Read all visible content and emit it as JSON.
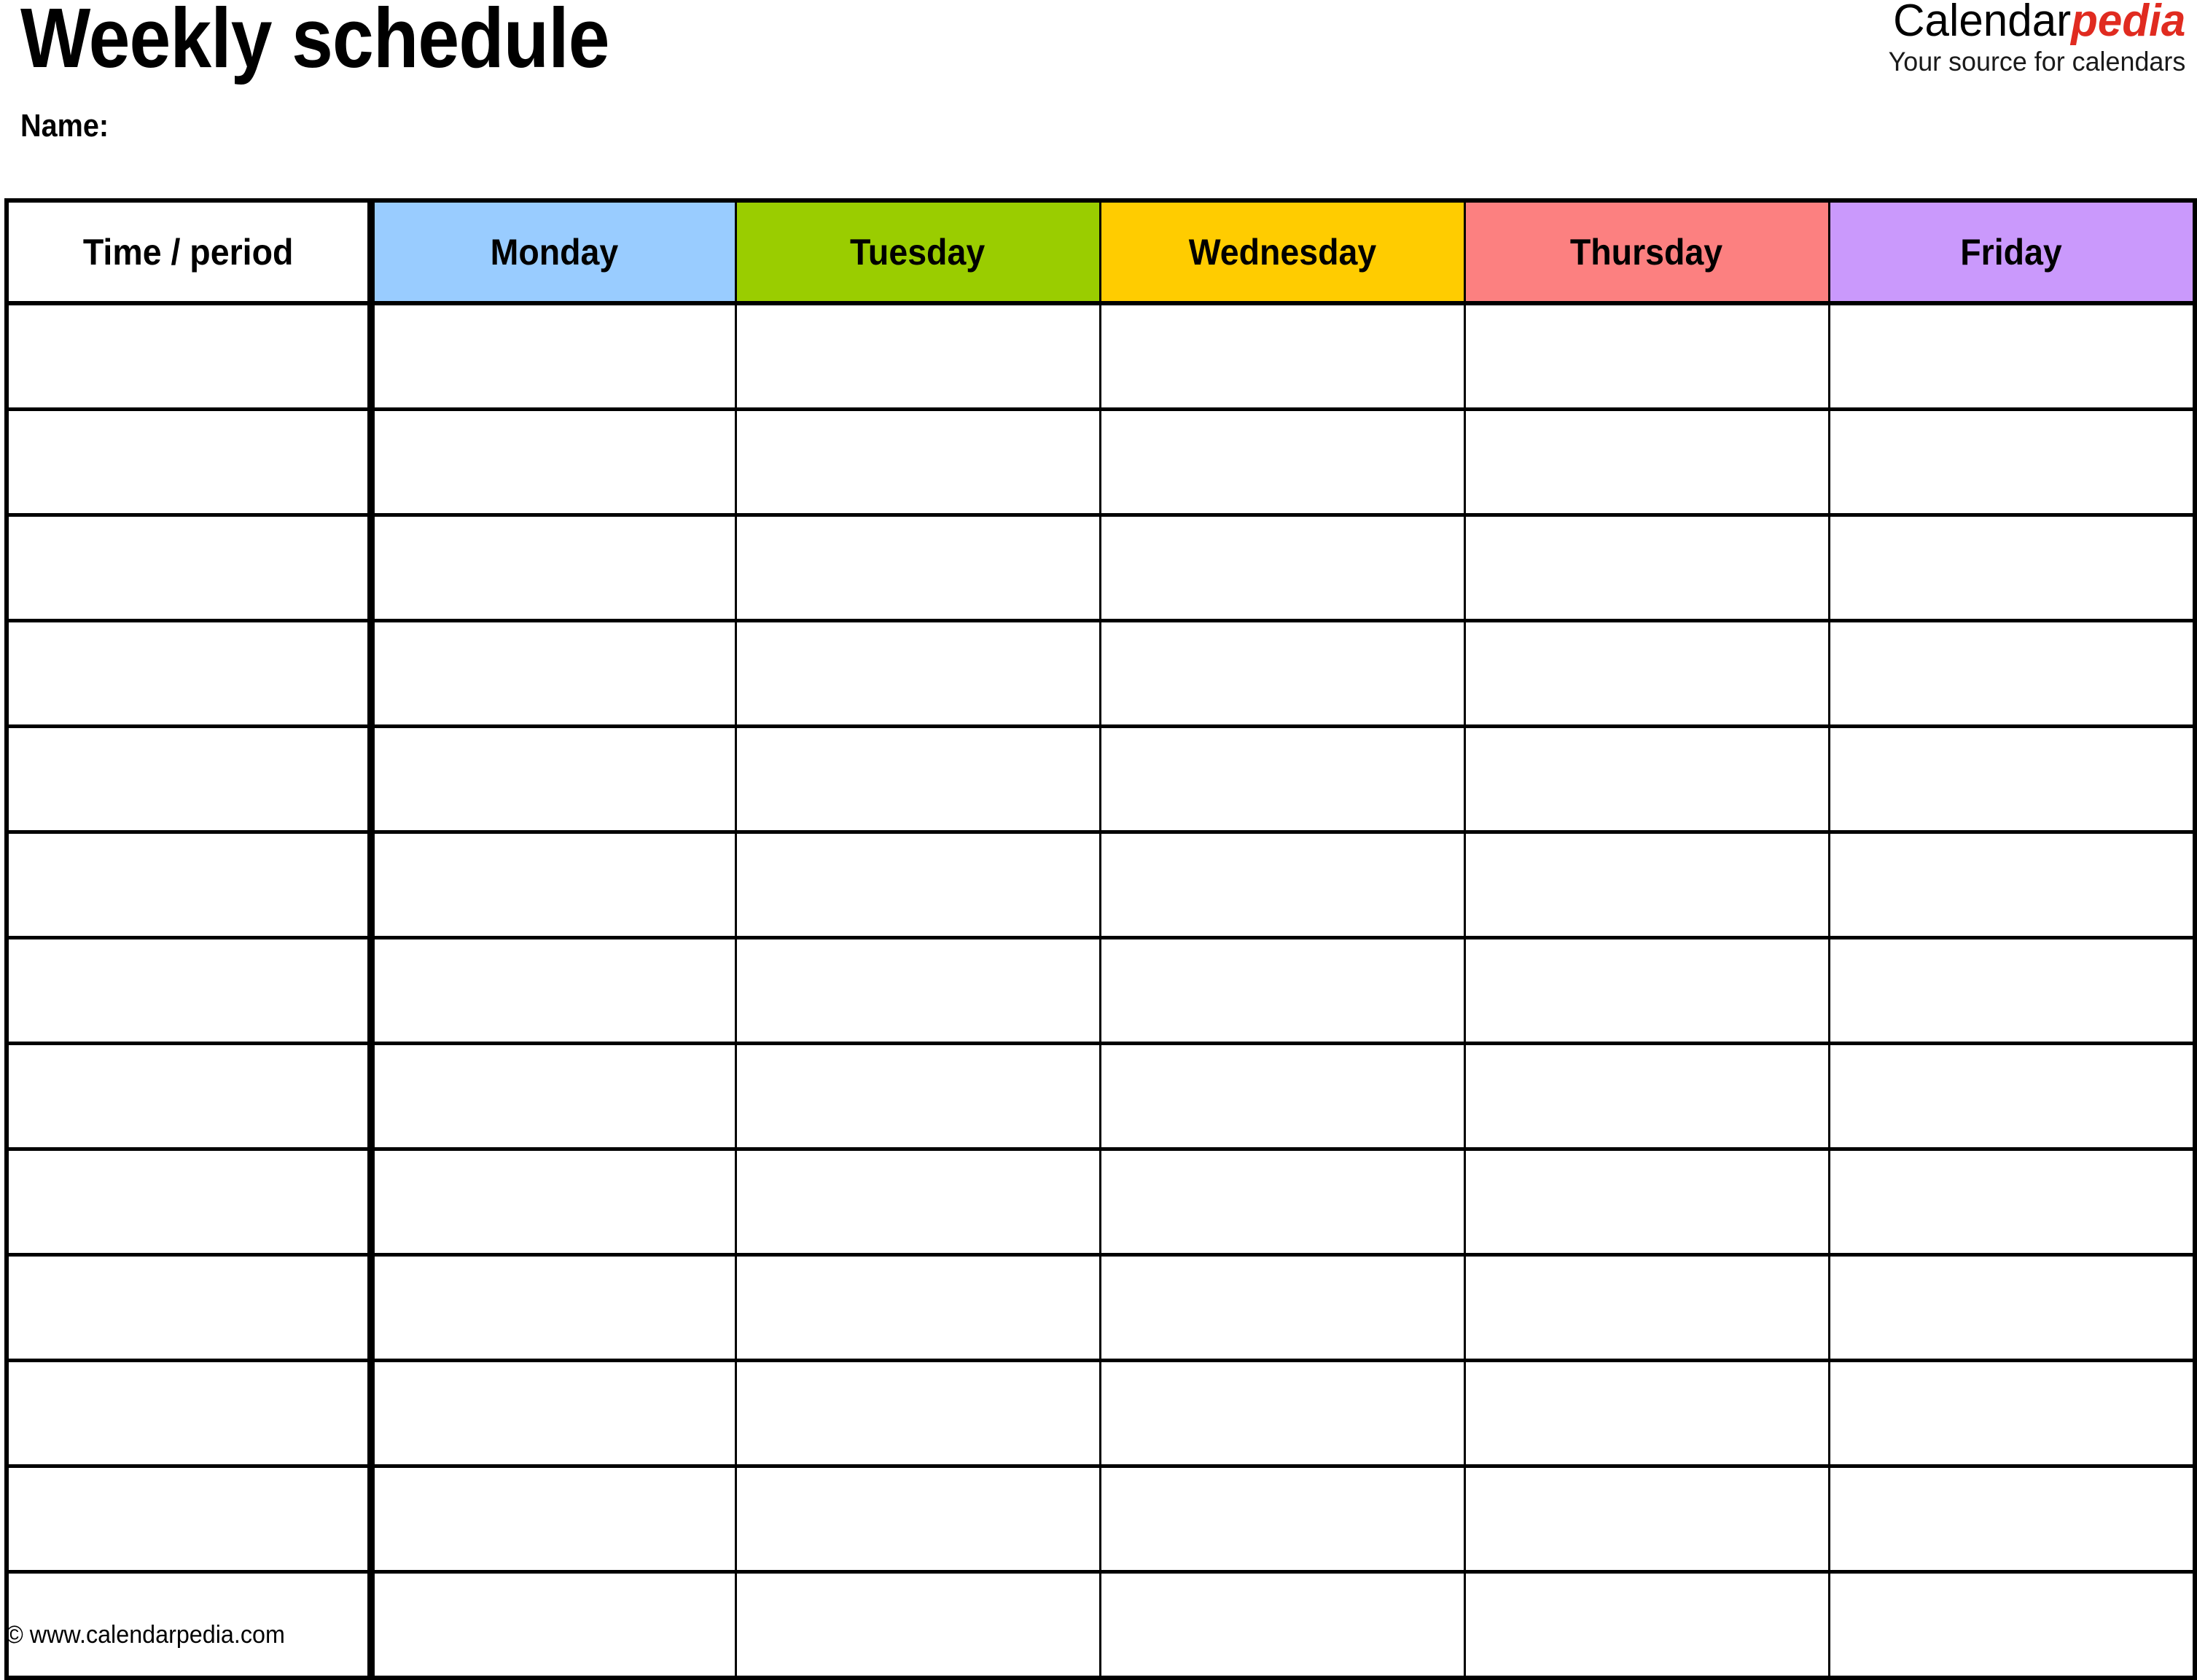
{
  "document": {
    "title": "Weekly schedule",
    "name_label": "Name:",
    "footer": "© www.calendarpedia.com"
  },
  "brand": {
    "name_black": "Calendar",
    "name_red": "pedia",
    "tagline": "Your source for calendars",
    "red_color": "#E02B20"
  },
  "table": {
    "columns": [
      {
        "label": "Time / period",
        "color": "#FFFFFF",
        "kind": "time"
      },
      {
        "label": "Monday",
        "color": "#99CCFF",
        "kind": "day"
      },
      {
        "label": "Tuesday",
        "color": "#9ACD00",
        "kind": "day"
      },
      {
        "label": "Wednesday",
        "color": "#FFCC00",
        "kind": "day"
      },
      {
        "label": "Thursday",
        "color": "#FC8080",
        "kind": "day"
      },
      {
        "label": "Friday",
        "color": "#CA99FC",
        "kind": "day"
      }
    ],
    "row_count": 13,
    "rows": [
      [
        "",
        "",
        "",
        "",
        "",
        ""
      ],
      [
        "",
        "",
        "",
        "",
        "",
        ""
      ],
      [
        "",
        "",
        "",
        "",
        "",
        ""
      ],
      [
        "",
        "",
        "",
        "",
        "",
        ""
      ],
      [
        "",
        "",
        "",
        "",
        "",
        ""
      ],
      [
        "",
        "",
        "",
        "",
        "",
        ""
      ],
      [
        "",
        "",
        "",
        "",
        "",
        ""
      ],
      [
        "",
        "",
        "",
        "",
        "",
        ""
      ],
      [
        "",
        "",
        "",
        "",
        "",
        ""
      ],
      [
        "",
        "",
        "",
        "",
        "",
        ""
      ],
      [
        "",
        "",
        "",
        "",
        "",
        ""
      ],
      [
        "",
        "",
        "",
        "",
        "",
        ""
      ],
      [
        "",
        "",
        "",
        "",
        "",
        ""
      ]
    ]
  }
}
